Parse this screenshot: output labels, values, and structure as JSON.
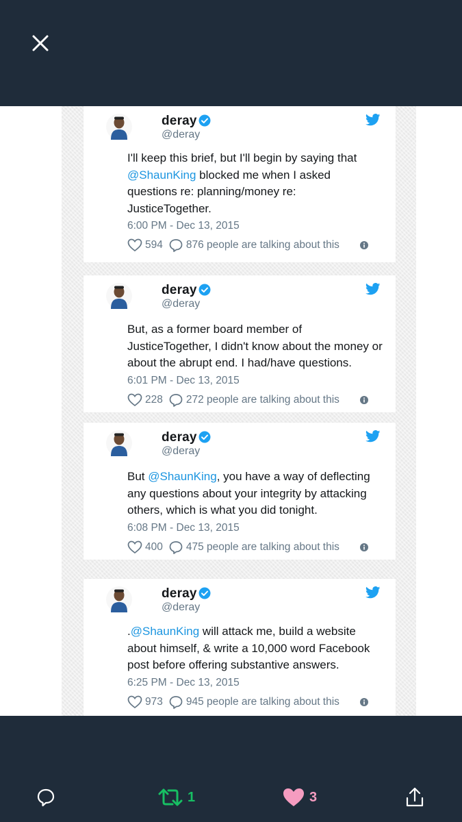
{
  "viewer": {
    "close_icon": "close-icon"
  },
  "tweets": [
    {
      "name": "deray",
      "handle": "@deray",
      "text_lines": [
        [
          {
            "t": "I'll keep this brief, but I'll begin by saying that",
            "m": false
          }
        ],
        [
          {
            "t": "@ShaunKing",
            "m": true
          },
          {
            "t": " blocked me when I asked",
            "m": false
          }
        ],
        [
          {
            "t": "questions re: planning/money re:",
            "m": false
          }
        ],
        [
          {
            "t": "JusticeTogether.",
            "m": false
          }
        ]
      ],
      "time": "6:00 PM - Dec 13, 2015",
      "likes": "594",
      "talking": "876 people are talking about this"
    },
    {
      "name": "deray",
      "handle": "@deray",
      "text_lines": [
        [
          {
            "t": "But, as a former board member of",
            "m": false
          }
        ],
        [
          {
            "t": "JusticeTogether, I didn't know about the money or",
            "m": false
          }
        ],
        [
          {
            "t": "about the abrupt end. I had/have questions.",
            "m": false
          }
        ]
      ],
      "time": "6:01 PM - Dec 13, 2015",
      "likes": "228",
      "talking": "272 people are talking about this"
    },
    {
      "name": "deray",
      "handle": "@deray",
      "text_lines": [
        [
          {
            "t": "But ",
            "m": false
          },
          {
            "t": "@ShaunKing",
            "m": true
          },
          {
            "t": ", you have a way of deflecting",
            "m": false
          }
        ],
        [
          {
            "t": "any questions about your integrity by attacking",
            "m": false
          }
        ],
        [
          {
            "t": "others, which is what you did tonight.",
            "m": false
          }
        ]
      ],
      "time": "6:08 PM - Dec 13, 2015",
      "likes": "400",
      "talking": "475 people are talking about this"
    },
    {
      "name": "deray",
      "handle": "@deray",
      "text_lines": [
        [
          {
            "t": ".",
            "m": false
          },
          {
            "t": "@ShaunKing",
            "m": true
          },
          {
            "t": " will attack me, build a website",
            "m": false
          }
        ],
        [
          {
            "t": "about himself, & write a 10,000 word Facebook",
            "m": false
          }
        ],
        [
          {
            "t": "post before offering substantive answers.",
            "m": false
          }
        ]
      ],
      "time": "6:25 PM - Dec 13, 2015",
      "likes": "973",
      "talking": "945 people are talking about this"
    }
  ],
  "bottom_bar": {
    "reply_icon": "reply-icon",
    "retweet_count": "1",
    "like_count": "3",
    "share_icon": "share-icon"
  },
  "colors": {
    "chrome": "#1f2c3a",
    "retweet": "#17bf63",
    "like": "#e0245e",
    "mention": "#1b95e0",
    "twitter_blue": "#1da1f2"
  }
}
